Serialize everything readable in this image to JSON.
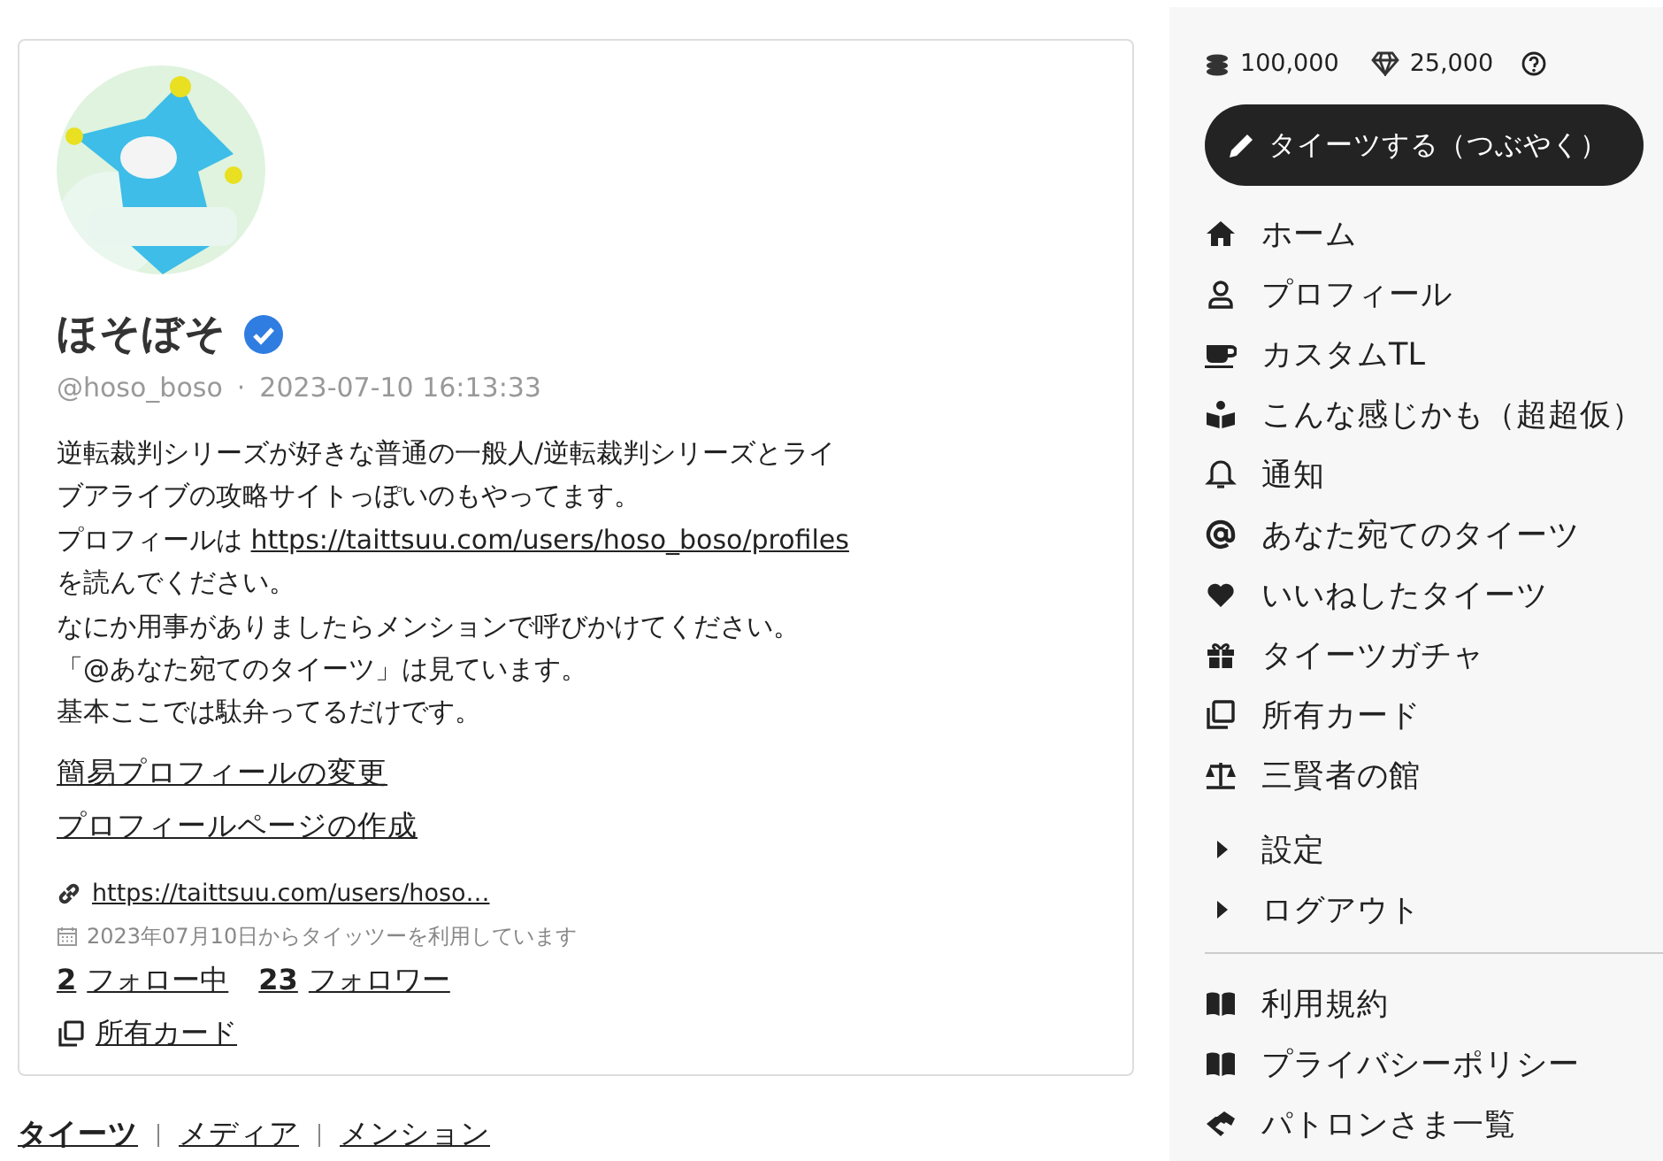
{
  "profile": {
    "name": "ほそぼそ",
    "verified": true,
    "handle": "@hoso_boso",
    "separator": "·",
    "created": "2023-07-10 16:13:33",
    "bio": [
      {
        "text": "逆転裁判シリーズが好きな普通の一般人/逆転裁判シリーズとライ"
      },
      {
        "text": "ブアライブの攻略サイトっぽいのもやってます。"
      },
      {
        "text": "プロフィールは ",
        "link": "https://taittsuu.com/users/hoso_boso/profiles"
      },
      {
        "text": "を読んでください。"
      },
      {
        "text": "なにか用事がありましたらメンションで呼びかけてください。"
      },
      {
        "text": "「@あなた宛てのタイーツ」は見ています。"
      },
      {
        "text": "基本ここでは駄弁ってるだけです。"
      }
    ],
    "actions": [
      "簡易プロフィールの変更",
      "プロフィールページの作成"
    ],
    "website": "https://taittsuu.com/users/hoso…",
    "joined": "2023年07月10日からタイッツーを利用しています",
    "following": {
      "count": "2",
      "label": "フォロー中"
    },
    "followers": {
      "count": "23",
      "label": "フォロワー"
    },
    "cards": "所有カード"
  },
  "tabs": [
    {
      "label": "タイーツ",
      "selected": true
    },
    {
      "label": "メディア",
      "selected": false
    },
    {
      "label": "メンション",
      "selected": false
    }
  ],
  "sidebar": {
    "coins": "100,000",
    "gems": "25,000",
    "post_button": "タイーツする（つぶやく）",
    "nav": [
      {
        "label": "ホーム"
      },
      {
        "label": "プロフィール"
      },
      {
        "label": "カスタムTL"
      },
      {
        "label": "こんな感じかも（超超仮）"
      },
      {
        "label": "通知"
      },
      {
        "label": "あなた宛てのタイーツ"
      },
      {
        "label": "いいねしたタイーツ"
      },
      {
        "label": "タイーツガチャ"
      },
      {
        "label": "所有カード"
      },
      {
        "label": "三賢者の館"
      }
    ],
    "menus": [
      {
        "label": "設定",
        "expanded": false
      },
      {
        "label": "ログアウト",
        "expanded": false
      }
    ],
    "footer": [
      {
        "label": "利用規約"
      },
      {
        "label": "プライバシーポリシー"
      },
      {
        "label": "パトロンさま一覧"
      }
    ]
  }
}
